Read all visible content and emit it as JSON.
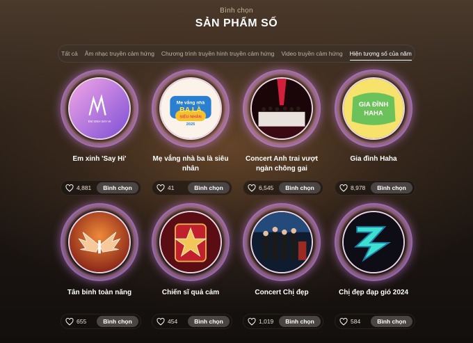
{
  "header": {
    "eyebrow": "Bình chọn",
    "title": "SẢN PHẨM SỐ"
  },
  "tabs": [
    {
      "label": "Tất cả",
      "active": false
    },
    {
      "label": "Âm nhạc truyền cảm hứng",
      "active": false
    },
    {
      "label": "Chương trình truyền hình truyền cảm hứng",
      "active": false
    },
    {
      "label": "Video truyền cảm hứng",
      "active": false
    },
    {
      "label": "Hiện tượng số của năm",
      "active": true
    }
  ],
  "vote_label": "Bình chọn",
  "items": [
    {
      "name": "Em xinh 'Say Hi'",
      "count": "4,881",
      "art_text": "EM XINH SAY HI"
    },
    {
      "name": "Mẹ vắng nhà ba là siêu nhân",
      "count": "41",
      "art_text": "Mẹ vắng nhà BA LÀ SIÊU NHÂN 2025"
    },
    {
      "name": "Concert Anh trai vượt ngàn chông gai",
      "count": "6,545"
    },
    {
      "name": "Gia đình Haha",
      "count": "8,978",
      "art_text": "GIA ĐÌNH HAHA"
    },
    {
      "name": "Tân binh toàn năng",
      "count": "655"
    },
    {
      "name": "Chiến sĩ quả cảm",
      "count": "454"
    },
    {
      "name": "Concert Chị đẹp",
      "count": "1,019"
    },
    {
      "name": "Chị đẹp đạp gió 2024",
      "count": "584"
    }
  ],
  "colors": {
    "accent_ring": "#e08cff",
    "vote_button": "#4a4543",
    "tab_bar": "#3c322a"
  }
}
